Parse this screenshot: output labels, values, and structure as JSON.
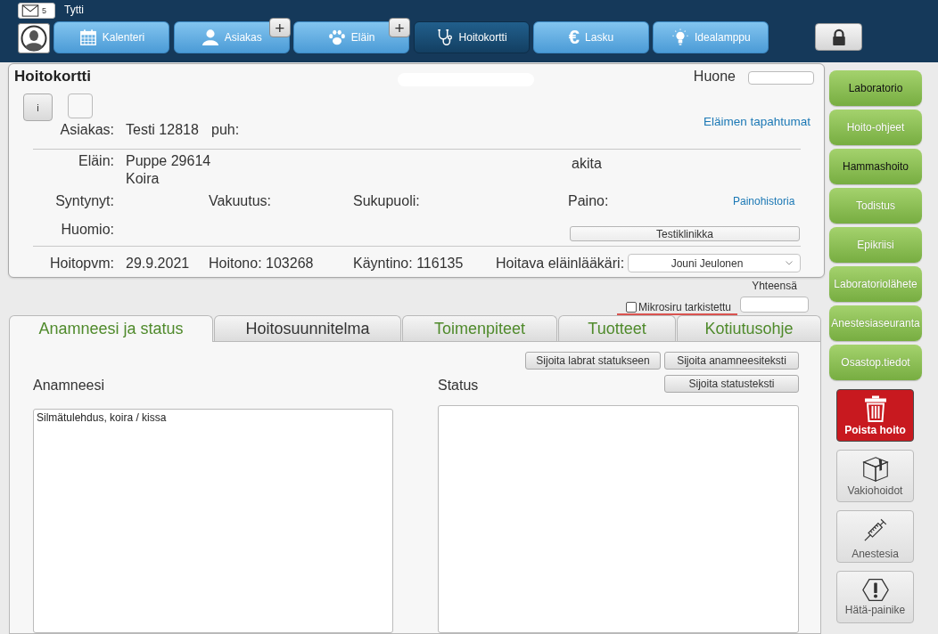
{
  "top_bar": {
    "mail": {
      "count": "5"
    },
    "user": "Tytti",
    "nav": [
      {
        "label": "Kalenteri",
        "selected": false
      },
      {
        "label": "Asiakas",
        "selected": false,
        "add": "+"
      },
      {
        "label": "Eläin",
        "selected": false,
        "add": "+"
      },
      {
        "label": "Hoitokortti",
        "selected": true
      },
      {
        "label": "Lasku",
        "selected": false,
        "symbol": "€"
      },
      {
        "label": "Idealamppu",
        "selected": false
      }
    ]
  },
  "card": {
    "title": "Hoitokortti",
    "room_label": "Huone",
    "info_button": "i",
    "events_link": "Eläimen tapahtumat",
    "customer": {
      "label": "Asiakas:",
      "value": "Testi 12818",
      "phone_label": "puh:"
    },
    "animal": {
      "label": "Eläin:",
      "name": "Puppe 29614",
      "species": "Koira",
      "breed": "akita"
    },
    "details": {
      "born_label": "Syntynyt:",
      "insurance_label": "Vakuutus:",
      "sex_label": "Sukupuoli:",
      "weight_label": "Paino:",
      "weight_history_link": "Painohistoria"
    },
    "note": {
      "label": "Huomio:",
      "clinic_button": "Testiklinikka"
    },
    "visit": {
      "date_label": "Hoitopvm:",
      "date": "29.9.2021",
      "treatment_no": "Hoitono: 103268",
      "visit_no": "Käyntino: 116135",
      "vet_label": "Hoitava eläinlääkäri:",
      "vet": "Jouni Jeulonen"
    }
  },
  "summary": {
    "total_label": "Yhteensä",
    "microchip": {
      "label": "Mikrosiru tarkistettu",
      "checked": false
    }
  },
  "tabs": [
    {
      "label": "Anamneesi ja status",
      "selected": true,
      "color": "#4f8a2b"
    },
    {
      "label": "Hoitosuunnitelma",
      "selected": false,
      "color": "#333333"
    },
    {
      "label": "Toimenpiteet",
      "selected": false,
      "color": "#4f8a2b"
    },
    {
      "label": "Tuotteet",
      "selected": false,
      "color": "#4f8a2b"
    },
    {
      "label": "Kotiutusohje",
      "selected": false,
      "color": "#4f8a2b"
    }
  ],
  "panel": {
    "buttons": [
      "Sijoita labrat statukseen",
      "Sijoita anamneesiteksti",
      "Sijoita statusteksti"
    ],
    "anamnesis": {
      "label": "Anamneesi",
      "value": "Silmätulehdus, koira / kissa"
    },
    "status": {
      "label": "Status"
    }
  },
  "sidebar": {
    "actions": [
      {
        "label": "Laboratorio",
        "dark_label": true
      },
      {
        "label": "Hoito-ohjeet",
        "dark_label": false
      },
      {
        "label": "Hammashoito",
        "dark_label": true
      },
      {
        "label": "Todistus",
        "dark_label": false
      },
      {
        "label": "Epikriisi",
        "dark_label": false
      },
      {
        "label": "Laboratoriolähete",
        "dark_label": false
      },
      {
        "label": "Anestesiaseuranta",
        "dark_label": false
      },
      {
        "label": "Osastop.tiedot",
        "dark_label": false
      }
    ],
    "tools": [
      {
        "label": "Poista hoito",
        "kind": "danger"
      },
      {
        "label": "Vakiohoidot",
        "kind": "plain"
      },
      {
        "label": "Anestesia",
        "kind": "plain"
      },
      {
        "label": "Hätä-painike",
        "kind": "plain"
      }
    ]
  }
}
